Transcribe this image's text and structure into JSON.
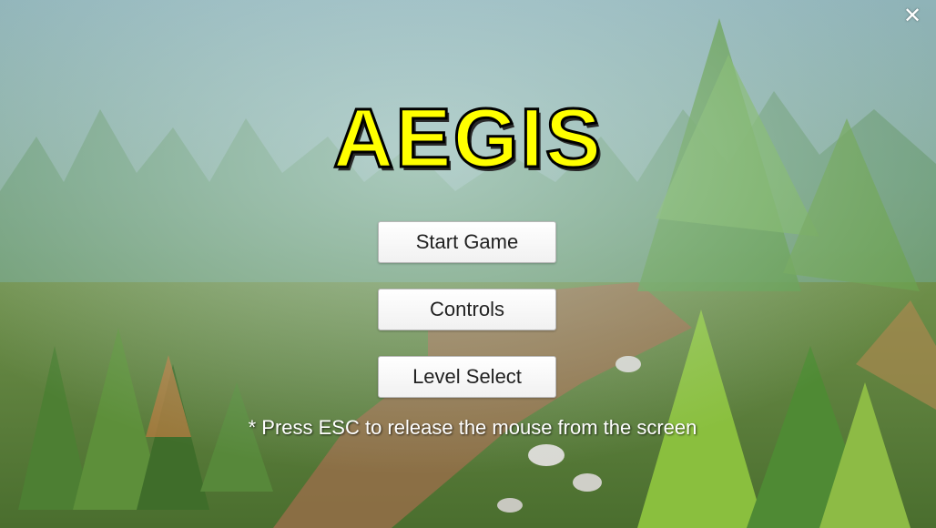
{
  "window": {
    "close_icon": "close-icon",
    "close_glyph": "✕"
  },
  "title": "AEGIS",
  "menu": {
    "start_label": "Start Game",
    "controls_label": "Controls",
    "level_select_label": "Level Select"
  },
  "hint": "* Press ESC to release the mouse from the screen",
  "colors": {
    "title_fill": "#ffff00",
    "title_outline": "#000000",
    "button_bg": "#ffffff",
    "button_text": "#222222",
    "hint_text": "#ffffff"
  }
}
